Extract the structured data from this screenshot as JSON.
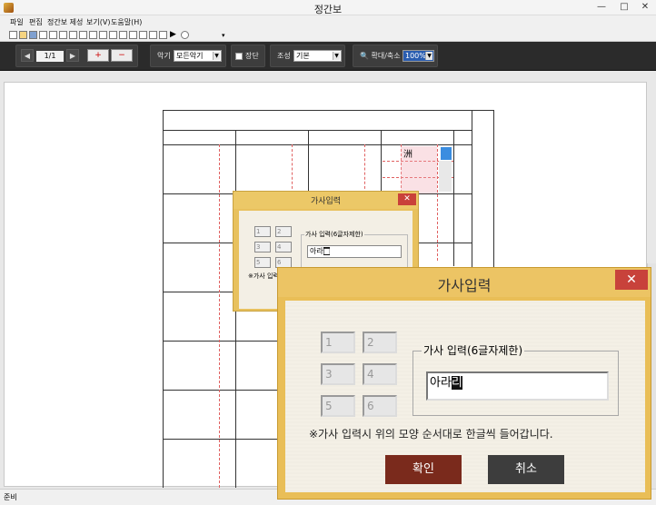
{
  "window": {
    "title": "정간보",
    "min_label": "—",
    "max_label": "□",
    "close_label": "✕"
  },
  "menu": {
    "file": "파일",
    "edit": "편집",
    "create": "정간보 제성",
    "view": "보기(V)",
    "help": "도움말(H)"
  },
  "toolbar": {
    "page": "1/1",
    "instrument_label": "악기",
    "instrument_value": "모든악기",
    "jangdan_label": "장단",
    "jo_label": "조성",
    "jo_value": "기본",
    "zoom_label": "확대/축소",
    "zoom_value": "100%"
  },
  "document": {
    "cell_char": "洲"
  },
  "small_dialog": {
    "title": "가사입력",
    "close": "✕",
    "boxes": [
      "1",
      "2",
      "3",
      "4",
      "5",
      "6"
    ],
    "group_label": "가사 입력(6글자제한)",
    "input_value": "아라",
    "note": "※가사 입력"
  },
  "big_dialog": {
    "title": "가사입력",
    "close": "✕",
    "boxes": [
      "1",
      "2",
      "3",
      "4",
      "5",
      "6"
    ],
    "group_label": "가사 입력(6글자제한)",
    "input_value": "아라",
    "cursor_char": "리",
    "note": "※가사 입력시  위의 모양 순서대로 한글씩 들어갑니다.",
    "ok": "확인",
    "cancel": "취소"
  },
  "status": {
    "text": "준비"
  }
}
